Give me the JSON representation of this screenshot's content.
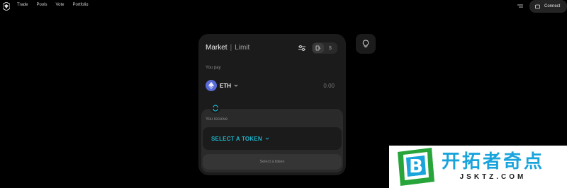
{
  "nav": {
    "items": [
      {
        "label": "Trade"
      },
      {
        "label": "Pools"
      },
      {
        "label": "Vote"
      },
      {
        "label": "Portfolio"
      }
    ],
    "connect_label": "Connect"
  },
  "swap": {
    "tab_market": "Market",
    "tab_separator": "|",
    "tab_limit": "Limit",
    "toggle_dollar": "$",
    "pay_label": "You pay",
    "pay_token": "ETH",
    "pay_amount": "0.00",
    "receive_label": "You receive",
    "receive_select": "SELECT A TOKEN",
    "action_button": "Select a token"
  },
  "watermark": {
    "letter": "B",
    "chinese": "开拓者奇点",
    "domain": "JSKTZ.COM"
  },
  "colors": {
    "accent_teal": "#1fb3c9",
    "eth_blue": "#5a6bd8",
    "card_bg": "#1b1b1b"
  },
  "icons": {
    "logo": "protocol-logo-icon",
    "menu": "menu-icon",
    "wallet": "wallet-icon",
    "settings": "sliders-icon",
    "gas": "gas-icon",
    "swap": "swap-arrows-icon",
    "bulb": "lightbulb-icon"
  }
}
